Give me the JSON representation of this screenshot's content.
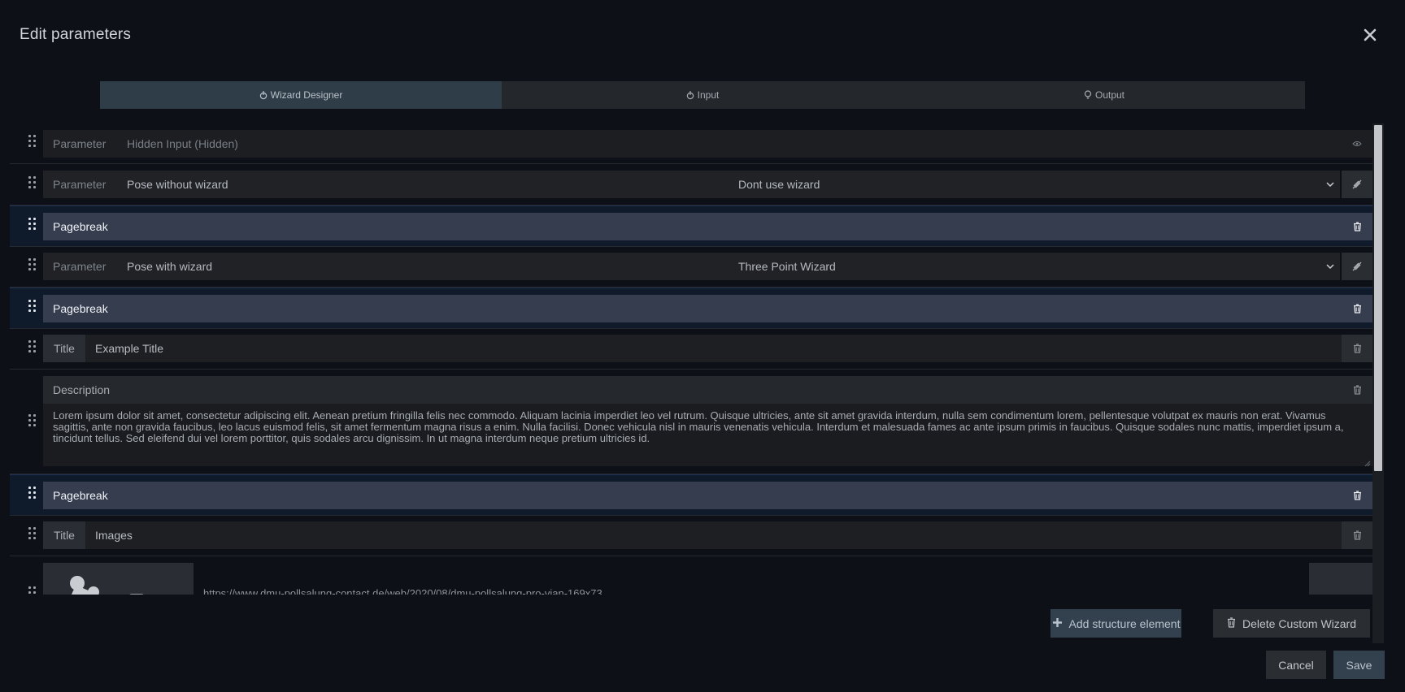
{
  "header": {
    "title": "Edit parameters"
  },
  "tabs": [
    {
      "label": "Wizard Designer",
      "icon": "wand-icon",
      "active": true
    },
    {
      "label": "Input",
      "icon": "wand-icon",
      "active": false
    },
    {
      "label": "Output",
      "icon": "lightbulb-icon",
      "active": false
    }
  ],
  "rows": {
    "hidden_input": {
      "tag": "Parameter",
      "value": "Hidden Input (Hidden)",
      "icon": "eye-icon"
    },
    "pose_without": {
      "tag": "Parameter",
      "value": "Pose without wizard",
      "select": "Dont use wizard",
      "icon": "no-link-icon"
    },
    "pagebreak1": {
      "label": "Pagebreak"
    },
    "pose_with": {
      "tag": "Parameter",
      "value": "Pose with wizard",
      "select": "Three Point Wizard",
      "icon": "no-link-icon"
    },
    "pagebreak2": {
      "label": "Pagebreak"
    },
    "title1": {
      "tag": "Title",
      "value": "Example Title"
    },
    "description": {
      "label": "Description",
      "text": "Lorem ipsum dolor sit amet, consectetur adipiscing elit. Aenean pretium fringilla felis nec commodo. Aliquam lacinia imperdiet leo vel rutrum. Quisque ultricies, ante sit amet gravida interdum, nulla sem condimentum lorem, pellentesque volutpat ex mauris non erat. Vivamus sagittis, ante non gravida faucibus, leo lacus euismod felis, sit amet fermentum magna risus a enim. Nulla facilisi. Donec vehicula nisl in mauris venenatis vehicula. Interdum et malesuada fames ac ante ipsum primis in faucibus. Quisque sodales nunc mattis, imperdiet ipsum a, tincidunt tellus. Sed eleifend dui vel lorem porttitor, quis sodales arcu dignissim. In ut magna interdum neque pretium ultricies id."
    },
    "pagebreak3": {
      "label": "Pagebreak"
    },
    "title2": {
      "tag": "Title",
      "value": "Images"
    },
    "image": {
      "url": "https://www.dmu-pollsalung-contact.de/web/2020/08/dmu-pollsalung-pro-vian-169x73"
    }
  },
  "footer": {
    "add_label": "Add structure element",
    "delete_label": "Delete Custom Wizard",
    "cancel_label": "Cancel",
    "save_label": "Save"
  },
  "colors": {
    "background": "#0d1016",
    "pagebreak": "#353d4f",
    "tab_active": "#2f3d48",
    "primary_button": "#33414e"
  }
}
